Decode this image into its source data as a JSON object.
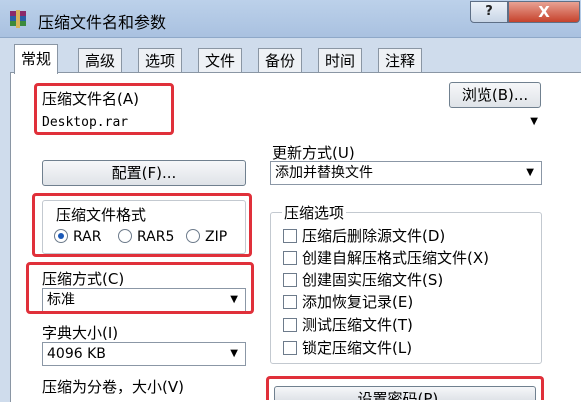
{
  "window": {
    "title": "压缩文件名和参数",
    "help_label": "?",
    "close_label": "X",
    "colors": {
      "highlight_border": "#e0303a",
      "radio_accent": "#1b59b7"
    }
  },
  "tabs": [
    {
      "label": "常规",
      "active": true
    },
    {
      "label": "高级"
    },
    {
      "label": "选项"
    },
    {
      "label": "文件"
    },
    {
      "label": "备份"
    },
    {
      "label": "时间"
    },
    {
      "label": "注释"
    }
  ],
  "general": {
    "archive_name_label": "压缩文件名(A)",
    "archive_name_value": "Desktop.rar",
    "browse_label": "浏览(B)...",
    "update_mode_label": "更新方式(U)",
    "update_mode_value": "添加并替换文件",
    "profiles_label": "配置(F)...",
    "format": {
      "label": "压缩文件格式",
      "options": [
        {
          "label": "RAR",
          "selected": true
        },
        {
          "label": "RAR5"
        },
        {
          "label": "ZIP"
        }
      ]
    },
    "method_label": "压缩方式(C)",
    "method_value": "标准",
    "dict_label": "字典大小(I)",
    "dict_value": "4096 KB",
    "split_label": "压缩为分卷，大小(V)",
    "set_password_label": "设置密码(P)...",
    "archive_options": {
      "label": "压缩选项",
      "items": [
        "压缩后删除源文件(D)",
        "创建自解压格式压缩文件(X)",
        "创建固实压缩文件(S)",
        "添加恢复记录(E)",
        "测试压缩文件(T)",
        "锁定压缩文件(L)"
      ]
    }
  }
}
